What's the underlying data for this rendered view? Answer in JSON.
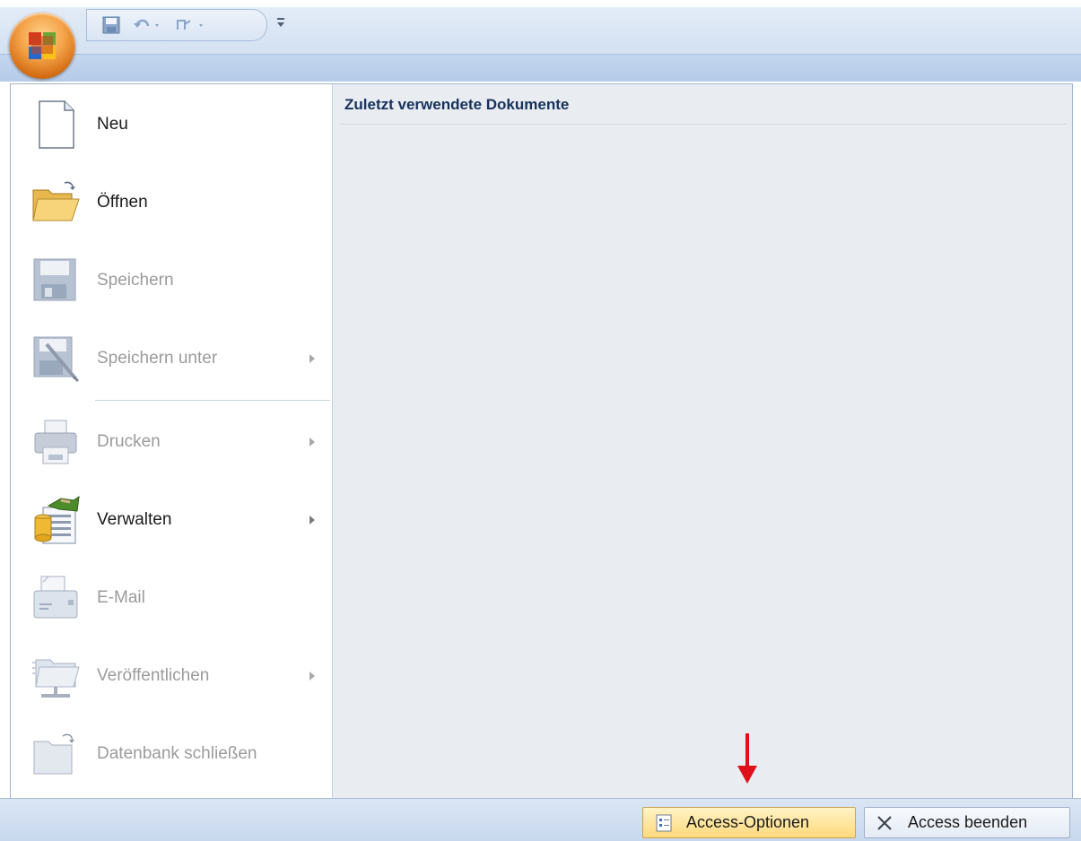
{
  "menu": {
    "items": [
      {
        "label": "Neu",
        "enabled": true,
        "submenu": false,
        "icon": "new-document-icon"
      },
      {
        "label": "Öffnen",
        "enabled": true,
        "submenu": false,
        "icon": "open-folder-icon"
      },
      {
        "label": "Speichern",
        "enabled": false,
        "submenu": false,
        "icon": "save-disk-icon"
      },
      {
        "label": "Speichern unter",
        "enabled": false,
        "submenu": true,
        "icon": "save-as-icon"
      },
      {
        "label": "Drucken",
        "enabled": false,
        "submenu": true,
        "icon": "printer-icon"
      },
      {
        "label": "Verwalten",
        "enabled": true,
        "submenu": true,
        "icon": "manage-database-icon"
      },
      {
        "label": "E-Mail",
        "enabled": false,
        "submenu": false,
        "icon": "email-icon"
      },
      {
        "label": "Veröffentlichen",
        "enabled": false,
        "submenu": true,
        "icon": "publish-icon"
      },
      {
        "label": "Datenbank schließen",
        "enabled": false,
        "submenu": false,
        "icon": "close-database-icon"
      }
    ]
  },
  "recent": {
    "title": "Zuletzt verwendete Dokumente"
  },
  "footer": {
    "options_label": "Access-Optionen",
    "exit_label": "Access beenden"
  },
  "colors": {
    "highlight": "#ffd97c",
    "arrow": "#e0101a",
    "heading": "#15315c"
  }
}
